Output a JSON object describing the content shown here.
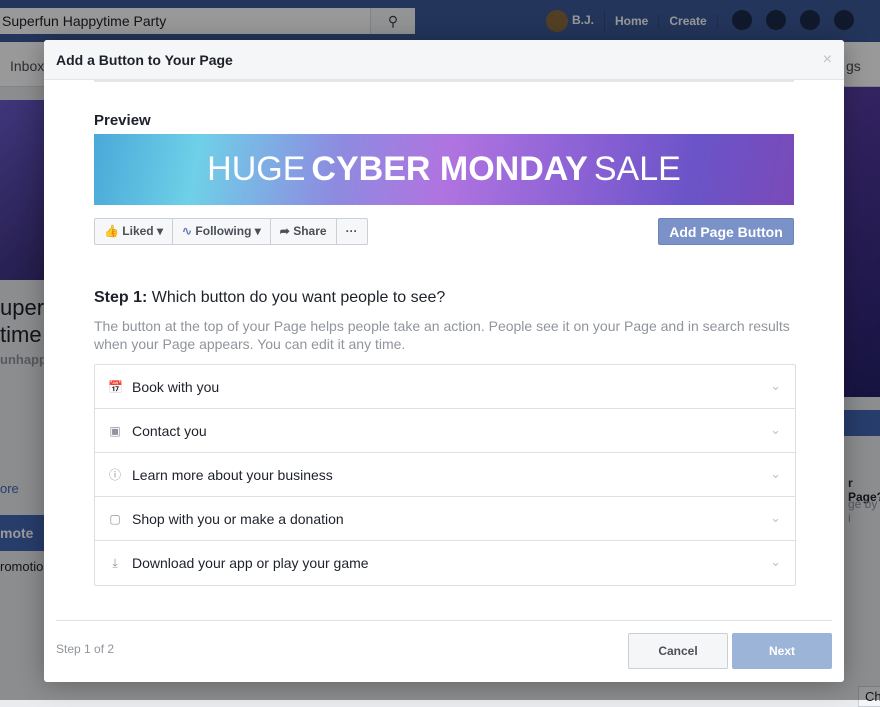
{
  "topbar": {
    "search_value": "Superfun Happytime Party",
    "user": "B.J.",
    "home": "Home",
    "create": "Create"
  },
  "background": {
    "subnav_left": "Inbox",
    "subnav_right": "gs",
    "page_name_1": "uperfu",
    "page_name_2": "time F",
    "handle": "unhapp",
    "more": "ore",
    "promote": "mote",
    "promotions": "romotio",
    "right_text_1": "r Page?",
    "right_text_2": "ge by i",
    "chat": "Ch"
  },
  "dialog": {
    "title": "Add a Button to Your Page",
    "close": "×",
    "preview_label": "Preview",
    "banner": {
      "word1": "HUGE",
      "word2": "CYBER MONDAY",
      "word3": "SALE"
    },
    "actions": {
      "liked": "Liked",
      "following": "Following",
      "share": "Share",
      "more": "···"
    },
    "add_page_button": "Add Page Button",
    "step_prefix": "Step 1:",
    "step_question": "Which button do you want people to see?",
    "description": "The button at the top of your Page helps people take an action. People see it on your Page and in search results when your Page appears. You can edit it any time.",
    "options": [
      {
        "label": "Book with you",
        "icon": "calendar-icon"
      },
      {
        "label": "Contact you",
        "icon": "chat-bubbles-icon"
      },
      {
        "label": "Learn more about your business",
        "icon": "info-icon"
      },
      {
        "label": "Shop with you or make a donation",
        "icon": "shopping-bag-icon"
      },
      {
        "label": "Download your app or play your game",
        "icon": "download-icon"
      }
    ],
    "step_count": "Step 1 of 2",
    "cancel": "Cancel",
    "next": "Next"
  }
}
